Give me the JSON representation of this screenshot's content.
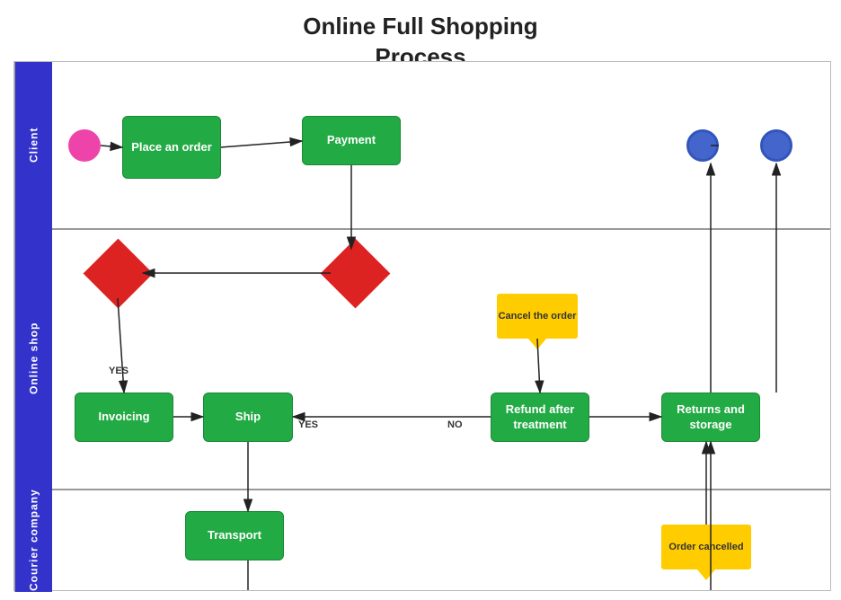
{
  "title": "Online Full Shopping\nProcess",
  "lanes": [
    {
      "id": "client",
      "label": "Client"
    },
    {
      "id": "online-shop",
      "label": "Online shop"
    },
    {
      "id": "courier",
      "label": "Courier company"
    }
  ],
  "shapes": {
    "place_order": "Place an order",
    "payment": "Payment",
    "invoicing": "Invoicing",
    "ship": "Ship",
    "transport": "Transport",
    "refund": "Refund after treatment",
    "returns": "Returns and storage",
    "cancel_order": "Cancel the order",
    "order_cancelled": "Order cancelled"
  },
  "labels": {
    "yes1": "YES",
    "yes2": "YES",
    "no": "NO"
  }
}
